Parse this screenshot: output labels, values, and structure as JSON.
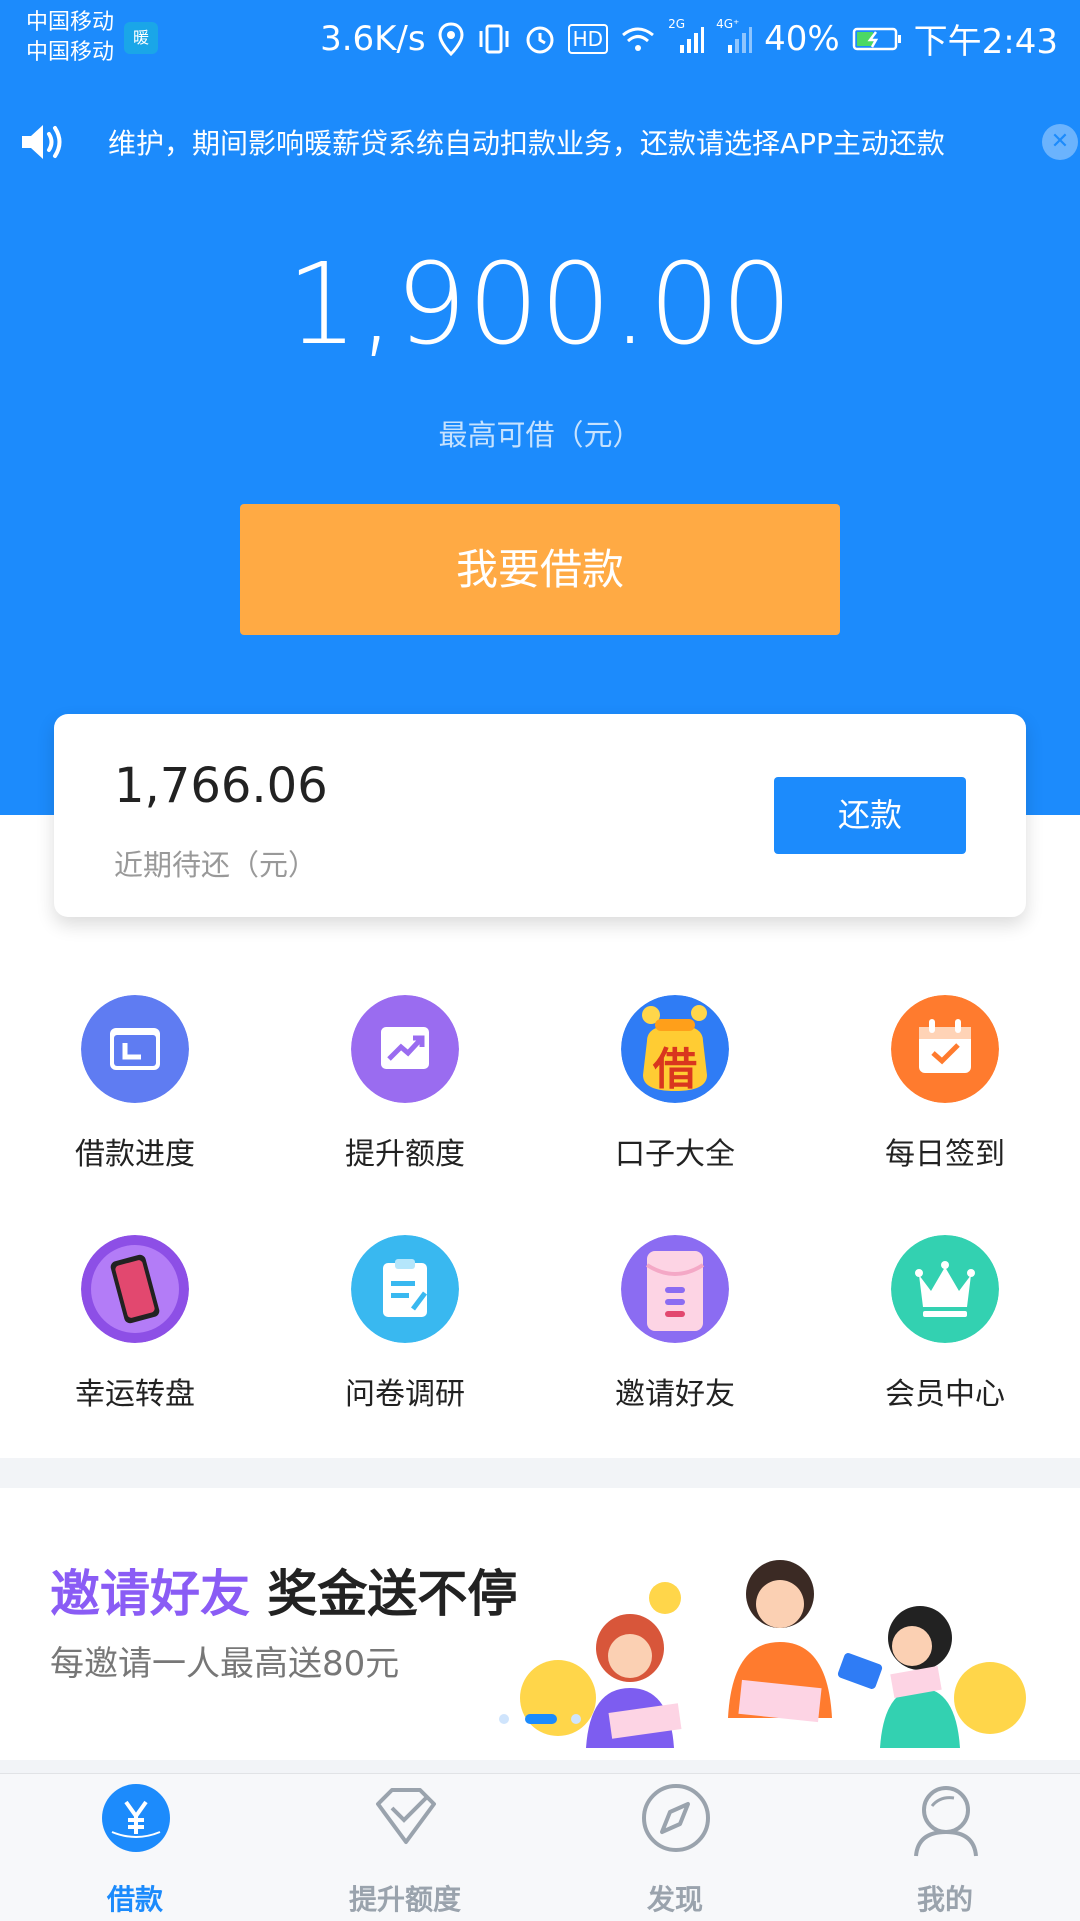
{
  "status_bar": {
    "carrier_1": "中国移动",
    "carrier_2": "中国移动",
    "app_badge": "暖",
    "net_speed": "3.6K/s",
    "hd": "HD",
    "net_2g": "2G",
    "net_4g": "4G⁺",
    "battery": "40%",
    "time": "下午2:43"
  },
  "notice": {
    "text": "维护，期间影响暖薪贷系统自动扣款业务，还款请选择APP主动还款",
    "close_glyph": "✕"
  },
  "loan": {
    "max_amount": "1,900.00",
    "max_label": "最高可借（元）",
    "borrow_button": "我要借款"
  },
  "repay_card": {
    "due_amount": "1,766.06",
    "due_label": "近期待还（元）",
    "repay_button": "还款"
  },
  "grid": [
    {
      "label": "借款进度",
      "icon": "folder-icon",
      "color": "#5f7cf2"
    },
    {
      "label": "提升额度",
      "icon": "trend-up-icon",
      "color": "#9a6cf0"
    },
    {
      "label": "口子大全",
      "icon": "money-bag-icon",
      "color": "#2f7cf5",
      "glyph": "借"
    },
    {
      "label": "每日签到",
      "icon": "calendar-check-icon",
      "color": "#ff7b2e"
    },
    {
      "label": "幸运转盘",
      "icon": "lucky-wheel-icon",
      "color": "#8d4fe6"
    },
    {
      "label": "问卷调研",
      "icon": "clipboard-icon",
      "color": "#39b8f0"
    },
    {
      "label": "邀请好友",
      "icon": "envelope-icon",
      "color": "#8b6cf2"
    },
    {
      "label": "会员中心",
      "icon": "crown-icon",
      "color": "#33d1b1"
    }
  ],
  "banner": {
    "title_highlight": "邀请好友",
    "title_rest": "奖金送不停",
    "subtitle": "每邀请一人最高送80元",
    "slide_index": 2,
    "slide_count": 3
  },
  "bottom_nav": [
    {
      "label": "借款",
      "icon": "yuan-coin-icon",
      "active": true
    },
    {
      "label": "提升额度",
      "icon": "shield-check-icon",
      "active": false
    },
    {
      "label": "发现",
      "icon": "compass-icon",
      "active": false
    },
    {
      "label": "我的",
      "icon": "user-icon",
      "active": false
    }
  ],
  "colors": {
    "primary": "#1c8bfc",
    "accent": "#ffaa44",
    "highlight": "#8a5cf5"
  }
}
